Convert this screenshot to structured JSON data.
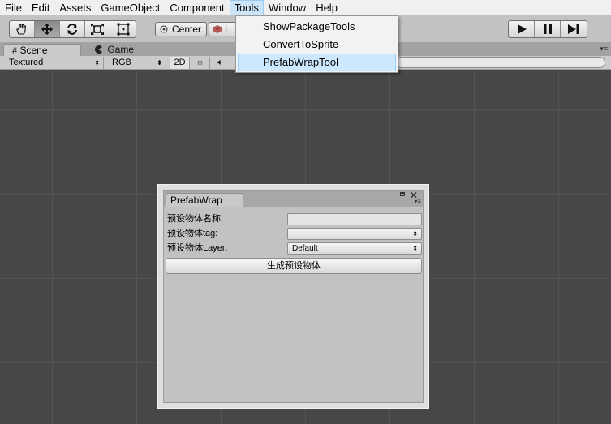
{
  "menubar": {
    "items": [
      "File",
      "Edit",
      "Assets",
      "GameObject",
      "Component",
      "Tools",
      "Window",
      "Help"
    ],
    "active_index": 5
  },
  "toolbar": {
    "tools": [
      {
        "name": "hand-tool",
        "icon": "hand-icon"
      },
      {
        "name": "move-tool",
        "icon": "move-arrows-icon"
      },
      {
        "name": "rotate-tool",
        "icon": "rotate-icon"
      },
      {
        "name": "scale-tool",
        "icon": "scale-icon"
      },
      {
        "name": "rect-tool",
        "icon": "rect-transform-icon"
      }
    ],
    "selected_tool_index": 1,
    "pivot_label": "Center",
    "space_label": "L",
    "playback": [
      {
        "name": "play-button",
        "icon": "play-icon"
      },
      {
        "name": "pause-button",
        "icon": "pause-icon"
      },
      {
        "name": "step-button",
        "icon": "step-icon"
      }
    ]
  },
  "tabs": {
    "scene": "Scene",
    "game": "Game"
  },
  "scenebar": {
    "shading_mode": "Textured",
    "render_mode": "RGB",
    "mode_2d": "2D"
  },
  "tools_menu": {
    "items": [
      "ShowPackageTools",
      "ConvertToSprite",
      "PrefabWrapTool"
    ],
    "hover_index": 2
  },
  "prefab_window": {
    "title": "PrefabWrap",
    "name_label": "预设物体名称:",
    "name_value": "",
    "tag_label": "预设物体tag:",
    "tag_value": "",
    "layer_label": "预设物体Layer:",
    "layer_value": "Default",
    "generate_button": "生成预设物体"
  },
  "colors": {
    "menu_active_bg": "#cce4f7",
    "dropdown_hover_bg": "#cce8ff",
    "viewport_bg": "#474747",
    "toolbar_bg": "#c2c2c2",
    "panel_bg": "#c2c2c2"
  }
}
